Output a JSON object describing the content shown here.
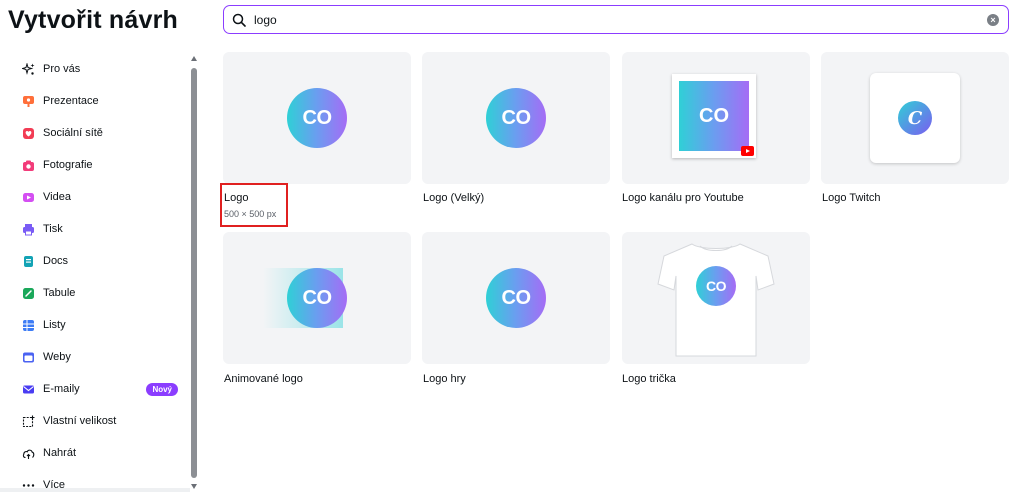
{
  "header": {
    "title": "Vytvořit návrh"
  },
  "search": {
    "value": "logo",
    "clear_icon": "clear-icon"
  },
  "sidebar": {
    "items": [
      {
        "label": "Pro vás",
        "icon": "sparkle-icon"
      },
      {
        "label": "Prezentace",
        "icon": "presentation-icon"
      },
      {
        "label": "Sociální sítě",
        "icon": "heart-icon"
      },
      {
        "label": "Fotografie",
        "icon": "camera-icon"
      },
      {
        "label": "Videa",
        "icon": "video-icon"
      },
      {
        "label": "Tisk",
        "icon": "printer-icon"
      },
      {
        "label": "Docs",
        "icon": "doc-icon"
      },
      {
        "label": "Tabule",
        "icon": "whiteboard-icon"
      },
      {
        "label": "Listy",
        "icon": "sheet-icon"
      },
      {
        "label": "Weby",
        "icon": "website-icon"
      },
      {
        "label": "E-maily",
        "icon": "email-icon",
        "badge": "Nový"
      },
      {
        "label": "Vlastní velikost",
        "icon": "custom-size-icon"
      },
      {
        "label": "Nahrát",
        "icon": "upload-icon"
      },
      {
        "label": "Více",
        "icon": "more-icon"
      }
    ]
  },
  "results": [
    {
      "label": "Logo",
      "sub": "500 × 500 px",
      "logo_text": "CO"
    },
    {
      "label": "Logo (Velký)",
      "logo_text": "CO"
    },
    {
      "label": "Logo kanálu pro Youtube",
      "logo_text": "CO"
    },
    {
      "label": "Logo Twitch",
      "logo_text": "C"
    },
    {
      "label": "Animované logo",
      "logo_text": "CO"
    },
    {
      "label": "Logo hry",
      "logo_text": "CO"
    },
    {
      "label": "Logo trička",
      "logo_text": "CO"
    }
  ],
  "colors": {
    "accent": "#8b3dff",
    "highlight": "#e02020",
    "card_bg": "#f3f4f6"
  }
}
